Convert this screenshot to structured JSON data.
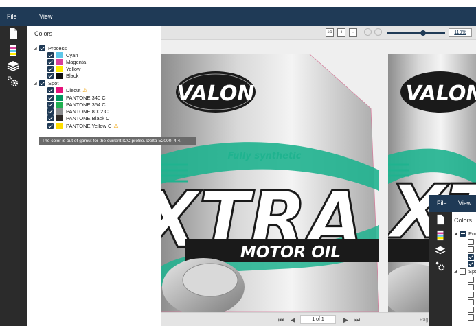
{
  "menu": {
    "file": "File",
    "view": "View"
  },
  "panel": {
    "title": "Colors",
    "groups": [
      {
        "label": "Process",
        "items": [
          {
            "label": "Cyan",
            "color": "#5ec6e8"
          },
          {
            "label": "Magenta",
            "color": "#d8419a"
          },
          {
            "label": "Yellow",
            "color": "#ffeb00"
          },
          {
            "label": "Black",
            "color": "#111111"
          }
        ]
      },
      {
        "label": "Spot",
        "items": [
          {
            "label": "Diecut",
            "color": "#e6117a",
            "warning": "⚠"
          },
          {
            "label": "PANTONE 340 C",
            "color": "#00965e"
          },
          {
            "label": "PANTONE 354 C",
            "color": "#1fb050"
          },
          {
            "label": "PANTONE 8002 C",
            "color": "#8a8c8e"
          },
          {
            "label": "PANTONE Black C",
            "color": "#2d2926"
          },
          {
            "label": "PANTONE Yellow C",
            "color": "#fedd00",
            "warning": "⚠"
          }
        ]
      }
    ]
  },
  "tooltip": "The color is out of gamut for the current ICC profile. Delta E2000: 4.4.",
  "view_toolbar": {
    "actual_size_label": "1:1",
    "zoom_value": "119%",
    "zoom_level": 0.62
  },
  "label_art": {
    "brand": "VALON",
    "tagline": "Fully synthetic",
    "product": "XTRA",
    "subtitle": "MOTOR OIL"
  },
  "pagination": {
    "page_field": "1 of 1",
    "page_label": "Pag"
  },
  "second_window": {
    "menu": {
      "file": "File",
      "view": "View"
    },
    "title": "Colors",
    "group_prefix_1": "Pro",
    "group_prefix_2": "Spo"
  },
  "colors": {
    "menubar": "#1f3a56",
    "toolstrip": "#2b2b2b",
    "accent_teal": "#1fb38f",
    "warning": "#f0a000"
  }
}
